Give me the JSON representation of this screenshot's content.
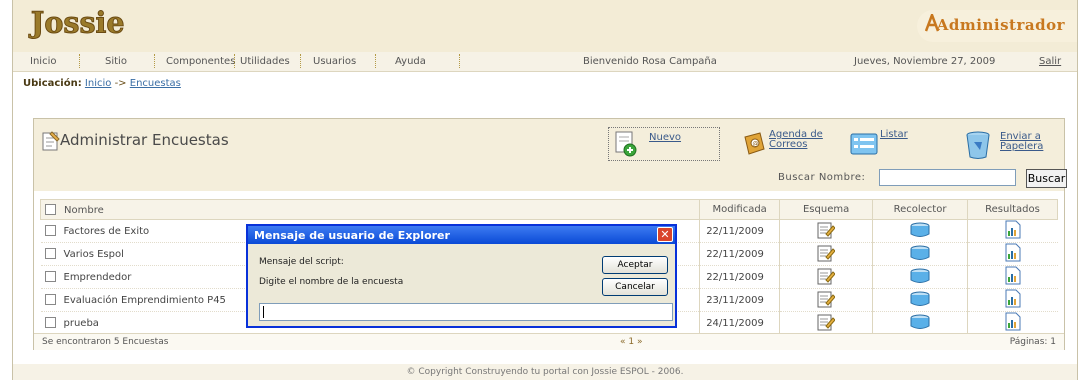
{
  "header": {
    "logo_text": "Jossie",
    "role_label": "Administrador"
  },
  "menu": {
    "items": [
      "Inicio",
      "Sitio",
      "Componentes",
      "Utilidades",
      "Usuarios",
      "Ayuda"
    ],
    "welcome": "Bienvenido Rosa Campaña",
    "date": "Jueves, Noviembre 27, 2009",
    "logout": "Salir"
  },
  "breadcrumb": {
    "label": "Ubicación:",
    "home": "Inicio",
    "sep": "->",
    "current": "Encuestas"
  },
  "panel": {
    "title": "Administrar Encuestas",
    "toolbar": {
      "new": "Nuevo",
      "contacts_1": "Agenda de",
      "contacts_2": "Correos",
      "list": "Listar",
      "trash_1": "Enviar a",
      "trash_2": "Papelera"
    },
    "search": {
      "label": "Buscar Nombre:",
      "value": "",
      "button": "Buscar"
    }
  },
  "table": {
    "headers": {
      "name": "Nombre",
      "modified": "Modificada",
      "schema": "Esquema",
      "collector": "Recolector",
      "results": "Resultados"
    },
    "rows": [
      {
        "name": "Factores de Exito",
        "modified": "22/11/2009"
      },
      {
        "name": "Varios Espol",
        "modified": "22/11/2009"
      },
      {
        "name": "Emprendedor",
        "modified": "22/11/2009"
      },
      {
        "name": "Evaluación Emprendimiento P45",
        "modified": "23/11/2009"
      },
      {
        "name": "prueba",
        "modified": "24/11/2009"
      }
    ]
  },
  "footer": {
    "count": "Se encontraron 5 Encuestas",
    "pager": "« 1 »",
    "pages": "Páginas: 1",
    "copyright": "© Copyright Construyendo tu portal con Jossie ESPOL - 2006."
  },
  "dialog": {
    "title": "Mensaje de usuario de Explorer",
    "close": "✕",
    "script_label": "Mensaje del script:",
    "prompt": "Digite el nombre de la encuesta",
    "ok": "Aceptar",
    "cancel": "Cancelar",
    "value": ""
  },
  "colors": {
    "header_bg": "#f3ecd6",
    "accent_orange": "#c8781f",
    "xp_blue": "#0a4ad6"
  }
}
